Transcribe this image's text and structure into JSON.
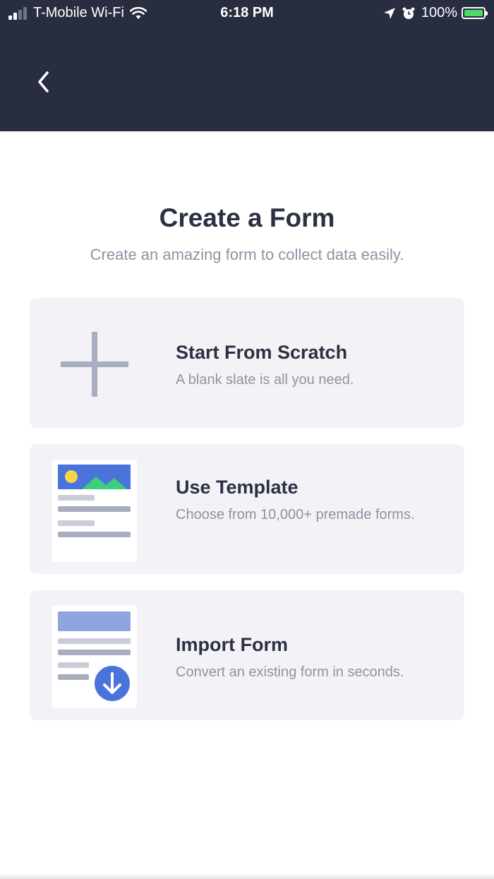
{
  "status_bar": {
    "carrier": "T-Mobile Wi-Fi",
    "time": "6:18 PM",
    "battery": "100%",
    "icons": [
      "signal-icon",
      "wifi-icon",
      "location-icon",
      "alarm-icon",
      "battery-charging-icon"
    ]
  },
  "header": {
    "back_icon": "chevron-left-icon"
  },
  "page": {
    "title": "Create a Form",
    "subtitle": "Create an amazing form to collect data easily."
  },
  "options": [
    {
      "title": "Start From Scratch",
      "desc": "A blank slate is all you need.",
      "icon": "plus-icon"
    },
    {
      "title": "Use Template",
      "desc": "Choose from 10,000+ premade forms.",
      "icon": "template-icon"
    },
    {
      "title": "Import Form",
      "desc": "Convert an existing form in seconds.",
      "icon": "import-form-icon"
    }
  ],
  "colors": {
    "header_bg": "#282d40",
    "card_bg": "#f3f3f7",
    "accent_blue": "#4a73db",
    "template_green": "#3ccf7e",
    "template_yellow": "#f9d449"
  }
}
